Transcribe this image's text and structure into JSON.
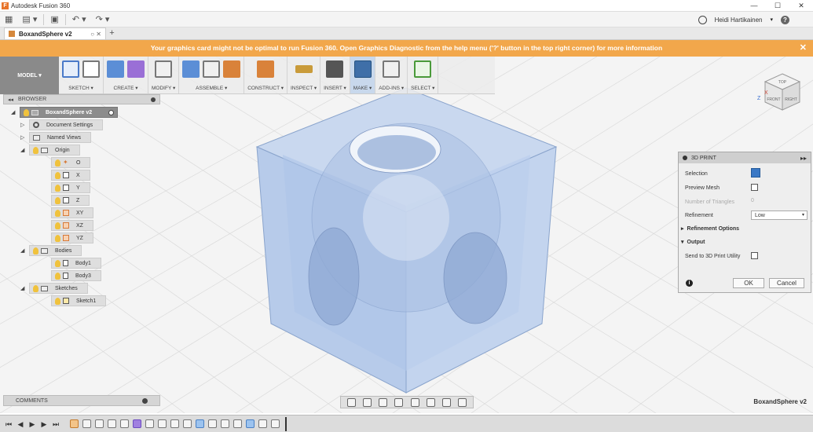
{
  "window": {
    "title": "Autodesk Fusion 360",
    "logo": "F"
  },
  "quick_access": {
    "icons": [
      "grid-icon",
      "file-icon",
      "save-icon",
      "undo-icon",
      "redo-icon"
    ]
  },
  "user": {
    "name": "Heidi Hartikainen"
  },
  "document_tab": {
    "title": "BoxandSphere v2"
  },
  "warning": {
    "text": "Your graphics card might not be optimal to run Fusion 360. Open Graphics Diagnostic from the help menu ('?' button in the top right corner) for more information"
  },
  "toolbar": {
    "workspace": "MODEL ▾",
    "groups": [
      {
        "label": "SKETCH ▾",
        "colors": [
          "#4a7ac9",
          "#777"
        ]
      },
      {
        "label": "CREATE ▾",
        "colors": [
          "#5b8ed6",
          "#9a6fd6"
        ]
      },
      {
        "label": "MODIFY ▾",
        "colors": [
          "#777"
        ]
      },
      {
        "label": "ASSEMBLE ▾",
        "colors": [
          "#5b8ed6",
          "#777",
          "#d9823a"
        ]
      },
      {
        "label": "CONSTRUCT ▾",
        "colors": [
          "#d9823a"
        ]
      },
      {
        "label": "INSPECT ▾",
        "colors": [
          "#c99b3a"
        ]
      },
      {
        "label": "INSERT ▾",
        "colors": [
          "#555"
        ]
      },
      {
        "label": "MAKE ▾",
        "colors": [
          "#3f6fa8"
        ]
      },
      {
        "label": "ADD-INS ▾",
        "colors": [
          "#777"
        ]
      },
      {
        "label": "SELECT ▾",
        "colors": [
          "#4a9a3a"
        ]
      }
    ]
  },
  "browser": {
    "title": "BROWSER",
    "root": "BoxandSphere v2",
    "items": [
      {
        "label": "Document Settings",
        "kind": "settings",
        "depth": 1,
        "tri": "▷"
      },
      {
        "label": "Named Views",
        "kind": "folder",
        "depth": 1,
        "tri": "▷"
      },
      {
        "label": "Origin",
        "kind": "folder",
        "depth": 1,
        "tri": "◢"
      },
      {
        "label": "O",
        "kind": "point",
        "depth": 2
      },
      {
        "label": "X",
        "kind": "axis",
        "depth": 2
      },
      {
        "label": "Y",
        "kind": "axis",
        "depth": 2
      },
      {
        "label": "Z",
        "kind": "axis",
        "depth": 2
      },
      {
        "label": "XY",
        "kind": "plane",
        "depth": 2
      },
      {
        "label": "XZ",
        "kind": "plane",
        "depth": 2
      },
      {
        "label": "YZ",
        "kind": "plane",
        "depth": 2
      },
      {
        "label": "Bodies",
        "kind": "folder",
        "depth": 1,
        "tri": "◢"
      },
      {
        "label": "Body1",
        "kind": "body",
        "depth": 2
      },
      {
        "label": "Body3",
        "kind": "body",
        "depth": 2
      },
      {
        "label": "Sketches",
        "kind": "folder",
        "depth": 1,
        "tri": "◢"
      },
      {
        "label": "Sketch1",
        "kind": "sketch",
        "depth": 2
      }
    ]
  },
  "viewcube": {
    "top": "TOP",
    "front": "FRONT",
    "right": "RIGHT",
    "axis_z": "Z",
    "axis_x": "X"
  },
  "print_panel": {
    "title": "3D PRINT",
    "selection_label": "Selection",
    "preview_label": "Preview Mesh",
    "triangles_label": "Number of Triangles",
    "triangles_value": "0",
    "refinement_label": "Refinement",
    "refinement_value": "Low",
    "refinement_options": "Refinement Options",
    "output_section": "Output",
    "send_label": "Send to 3D Print Utility",
    "ok": "OK",
    "cancel": "Cancel"
  },
  "comments": {
    "title": "COMMENTS"
  },
  "statusbar": {
    "doc_name": "BoxandSphere v2"
  },
  "timeline": {
    "controls": [
      "⏮",
      "◀",
      "▶",
      "▶",
      "⏭"
    ],
    "features": [
      "o",
      "n",
      "n",
      "n",
      "n",
      "p",
      "n",
      "n",
      "n",
      "n",
      "b",
      "n",
      "n",
      "n",
      "b",
      "n",
      "n"
    ]
  }
}
